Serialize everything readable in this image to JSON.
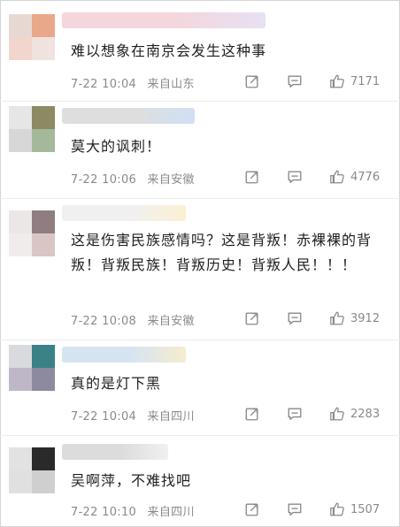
{
  "comments": [
    {
      "text": "难以想象在南京会发生这种事",
      "time": "7-22 10:04",
      "location": "来自山东",
      "likes": "7171",
      "avatar_colors": [
        "#e8d8d4",
        "#e8a889",
        "#f2d5cc",
        "#efe3e0"
      ],
      "nick_colors": [
        "#f4d6dc",
        "#e7e1f4"
      ]
    },
    {
      "text": "莫大的讽刺！",
      "time": "7-22 10:06",
      "location": "来自安徽",
      "likes": "4776",
      "avatar_colors": [
        "#e6e6e6",
        "#8b8a62",
        "#d7d7d7",
        "#a4b99a"
      ],
      "nick_colors": [
        "#dedede",
        "#cfe0f4"
      ]
    },
    {
      "text": "这是伤害民族感情吗？这是背叛！赤裸裸的背叛！背叛民族！背叛历史！背叛人民！！！",
      "time": "7-22 10:08",
      "location": "来自安徽",
      "likes": "3912",
      "avatar_colors": [
        "#ebe7e6",
        "#8f7d80",
        "#f0ecec",
        "#d9c6c4"
      ],
      "nick_colors": [
        "#f0f0f0",
        "#faf0d2"
      ]
    },
    {
      "text": "真的是灯下黑",
      "time": "7-22 10:04",
      "location": "来自四川",
      "likes": "2283",
      "avatar_colors": [
        "#d8dadd",
        "#3a8285",
        "#bdb7c8",
        "#8d8aa0"
      ],
      "nick_colors": [
        "#d6e4f2",
        "#f6ecd0"
      ]
    },
    {
      "text": "吴啊萍，不难找吧",
      "time": "7-22 10:10",
      "location": "来自四川",
      "likes": "1507",
      "avatar_colors": [
        "#e2e2e2",
        "#2a2a2a",
        "#e0e0e0",
        "#cfcfcf"
      ],
      "nick_colors": [
        "#dcdcdc",
        "#f0f0f0"
      ]
    }
  ],
  "icons": {
    "share": "share-icon",
    "comment": "comment-icon",
    "like": "thumbs-up-icon"
  }
}
